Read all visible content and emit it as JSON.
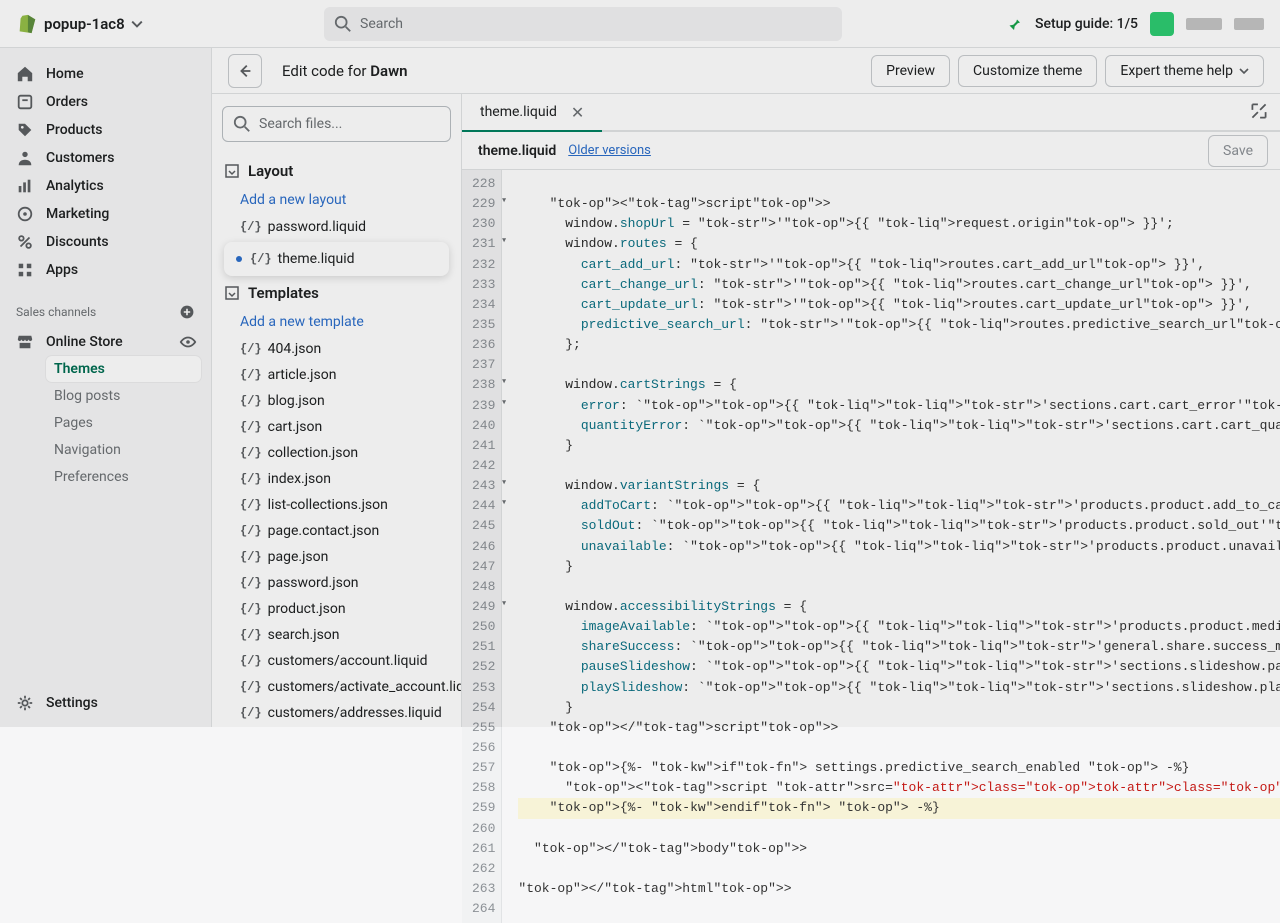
{
  "topbar": {
    "store_name": "popup-1ac8",
    "search_placeholder": "Search",
    "setup_guide": "Setup guide: 1/5"
  },
  "nav": {
    "home": "Home",
    "orders": "Orders",
    "products": "Products",
    "customers": "Customers",
    "analytics": "Analytics",
    "marketing": "Marketing",
    "discounts": "Discounts",
    "apps": "Apps",
    "sales_channels": "Sales channels",
    "online_store": "Online Store",
    "sub": {
      "themes": "Themes",
      "blog_posts": "Blog posts",
      "pages": "Pages",
      "navigation": "Navigation",
      "preferences": "Preferences"
    },
    "settings": "Settings"
  },
  "subheader": {
    "prefix": "Edit code for ",
    "theme": "Dawn",
    "actions": {
      "preview": "Preview",
      "customize": "Customize theme",
      "expert": "Expert theme help"
    }
  },
  "filetree": {
    "search_placeholder": "Search files...",
    "layout_label": "Layout",
    "add_layout": "Add a new layout",
    "layout_files": [
      "password.liquid",
      "theme.liquid"
    ],
    "templates_label": "Templates",
    "add_template": "Add a new template",
    "template_files": [
      "404.json",
      "article.json",
      "blog.json",
      "cart.json",
      "collection.json",
      "index.json",
      "list-collections.json",
      "page.contact.json",
      "page.json",
      "password.json",
      "product.json",
      "search.json",
      "customers/account.liquid",
      "customers/activate_account.liquid",
      "customers/addresses.liquid"
    ]
  },
  "editor": {
    "tab": "theme.liquid",
    "filename": "theme.liquid",
    "older_versions": "Older versions",
    "save": "Save",
    "first_line": 228,
    "lines": [
      "",
      "    <script>",
      "      window.shopUrl = '{{ request.origin }}';",
      "      window.routes = {",
      "        cart_add_url: '{{ routes.cart_add_url }}',",
      "        cart_change_url: '{{ routes.cart_change_url }}',",
      "        cart_update_url: '{{ routes.cart_update_url }}',",
      "        predictive_search_url: '{{ routes.predictive_search_url }}'",
      "      };",
      "",
      "      window.cartStrings = {",
      "        error: `{{ 'sections.cart.cart_error' | t }}`,",
      "        quantityError: `{{ 'sections.cart.cart_quantity_error_html' | t: quantity: '[quantity]' }}`",
      "      }",
      "",
      "      window.variantStrings = {",
      "        addToCart: `{{ 'products.product.add_to_cart' | t }}`,",
      "        soldOut: `{{ 'products.product.sold_out' | t }}`,",
      "        unavailable: `{{ 'products.product.unavailable' | t }}`,",
      "      }",
      "",
      "      window.accessibilityStrings = {",
      "        imageAvailable: `{{ 'products.product.media.image_available' | t: index: '[index]' }}`,",
      "        shareSuccess: `{{ 'general.share.success_message' | t }}`,",
      "        pauseSlideshow: `{{ 'sections.slideshow.pause_slideshow' | t }}`,",
      "        playSlideshow: `{{ 'sections.slideshow.play_slideshow' | t }}`,",
      "      }",
      "    </script>",
      "",
      "    {%- if settings.predictive_search_enabled -%}",
      "      <script src=\"{{ 'predictive-search.js' | asset_url }}\" defer=\"defer\"></script>",
      "    {%- endif -%}",
      "",
      "  </body>",
      "",
      "</html>",
      ""
    ]
  }
}
